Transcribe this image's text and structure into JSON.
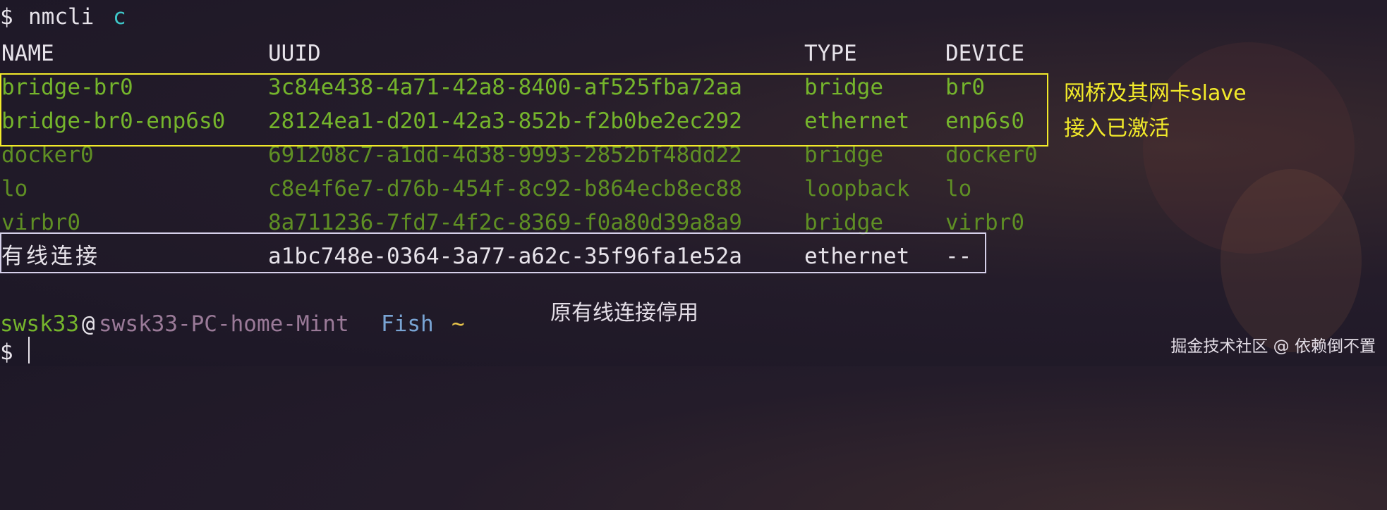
{
  "prompt1": {
    "symbol": "$",
    "command": "nmcli",
    "arg": "c"
  },
  "headers": {
    "name": "NAME",
    "uuid": "UUID",
    "type": "TYPE",
    "device": "DEVICE"
  },
  "rows": [
    {
      "name": "bridge-br0",
      "uuid": "3c84e438-4a71-42a8-8400-af525fba72aa",
      "type": "bridge",
      "device": "br0"
    },
    {
      "name": "bridge-br0-enp6s0",
      "uuid": "28124ea1-d201-42a3-852b-f2b0be2ec292",
      "type": "ethernet",
      "device": "enp6s0"
    },
    {
      "name": "docker0",
      "uuid": "691208c7-a1dd-4d38-9993-2852bf48dd22",
      "type": "bridge",
      "device": "docker0"
    },
    {
      "name": "lo",
      "uuid": "c8e4f6e7-d76b-454f-8c92-b864ecb8ec88",
      "type": "loopback",
      "device": "lo"
    },
    {
      "name": "virbr0",
      "uuid": "8a711236-7fd7-4f2c-8369-f0a80d39a8a9",
      "type": "bridge",
      "device": "virbr0"
    },
    {
      "name": "有线连接",
      "uuid": "a1bc748e-0364-3a77-a62c-35f96fa1e52a",
      "type": "ethernet",
      "device": "--"
    }
  ],
  "prompt2": {
    "user": "swsk33",
    "at": "@",
    "host": "swsk33-PC-home-Mint",
    "shell": "Fish",
    "cwd": "~"
  },
  "prompt3": {
    "symbol": "$"
  },
  "annotations": {
    "active_line1": "网桥及其网卡slave",
    "active_line2": "接入已激活",
    "disabled": "原有线连接停用"
  },
  "watermark": "掘金技术社区 @ 依赖倒不置",
  "colors": {
    "active_box": "#f2ea2a",
    "disabled_box": "#d6d0ea",
    "note_yellow": "#f2ea2a",
    "note_white": "#e3dde6"
  }
}
